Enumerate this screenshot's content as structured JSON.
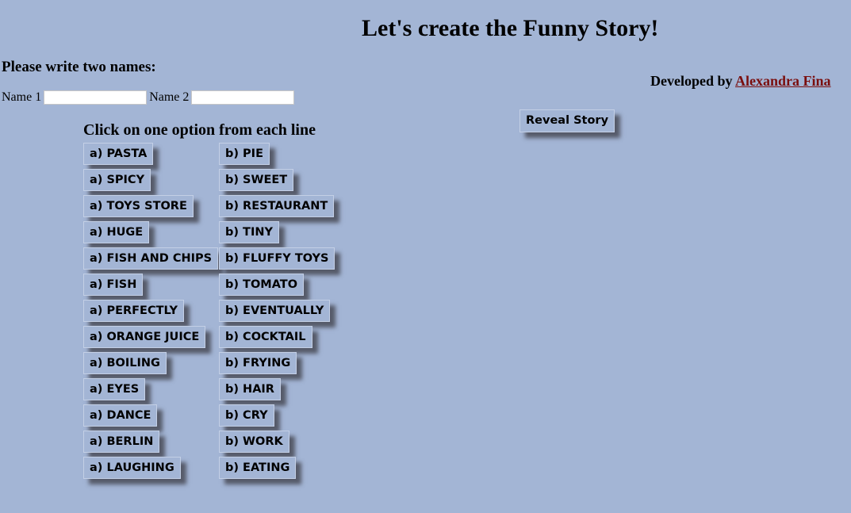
{
  "title": "Let's create the Funny Story!",
  "names_heading": "Please write two names:",
  "name1_label": "Name 1",
  "name2_label": "Name 2",
  "name1_value": "",
  "name2_value": "",
  "developer": {
    "prefix": "Developed by",
    "name": "Alexandra Fina"
  },
  "reveal_button": "Reveal Story",
  "instructions": "Click on one option from each line",
  "options": [
    {
      "a": "a) PASTA",
      "b": "b) PIE"
    },
    {
      "a": "a) SPICY",
      "b": "b) SWEET"
    },
    {
      "a": "a) TOYS STORE",
      "b": "b) RESTAURANT"
    },
    {
      "a": "a) HUGE",
      "b": "b) TINY"
    },
    {
      "a": "a) FISH AND CHIPS",
      "b": "b) FLUFFY TOYS"
    },
    {
      "a": "a) FISH",
      "b": "b) TOMATO"
    },
    {
      "a": "a) PERFECTLY",
      "b": "b) EVENTUALLY"
    },
    {
      "a": "a) ORANGE JUICE",
      "b": "b) COCKTAIL"
    },
    {
      "a": "a) BOILING",
      "b": "b) FRYING"
    },
    {
      "a": "a) EYES",
      "b": "b) HAIR"
    },
    {
      "a": "a) DANCE",
      "b": "b) CRY"
    },
    {
      "a": "a) BERLIN",
      "b": "b) WORK"
    },
    {
      "a": "a) LAUGHING",
      "b": "b) EATING"
    }
  ],
  "colors": {
    "background": "#a3b5d5",
    "link": "#7a0e0e"
  }
}
